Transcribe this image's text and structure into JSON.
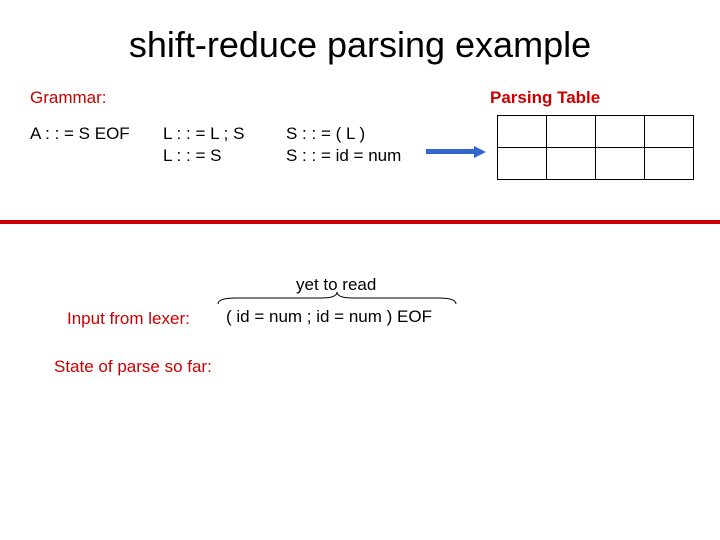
{
  "title": "shift-reduce parsing example",
  "grammar_label": "Grammar:",
  "parsing_table_label": "Parsing Table",
  "rules": {
    "a": "A : : = S EOF",
    "l1": "L : : = L ; S",
    "l2": "L : : = S",
    "s1": "S : : = ( L )",
    "s2": "S : : = id = num"
  },
  "yet_to_read": "yet to read",
  "input_label": "Input from lexer:",
  "input_stream": "( id = num ; id = num ) EOF",
  "state_label": "State of parse so far:"
}
